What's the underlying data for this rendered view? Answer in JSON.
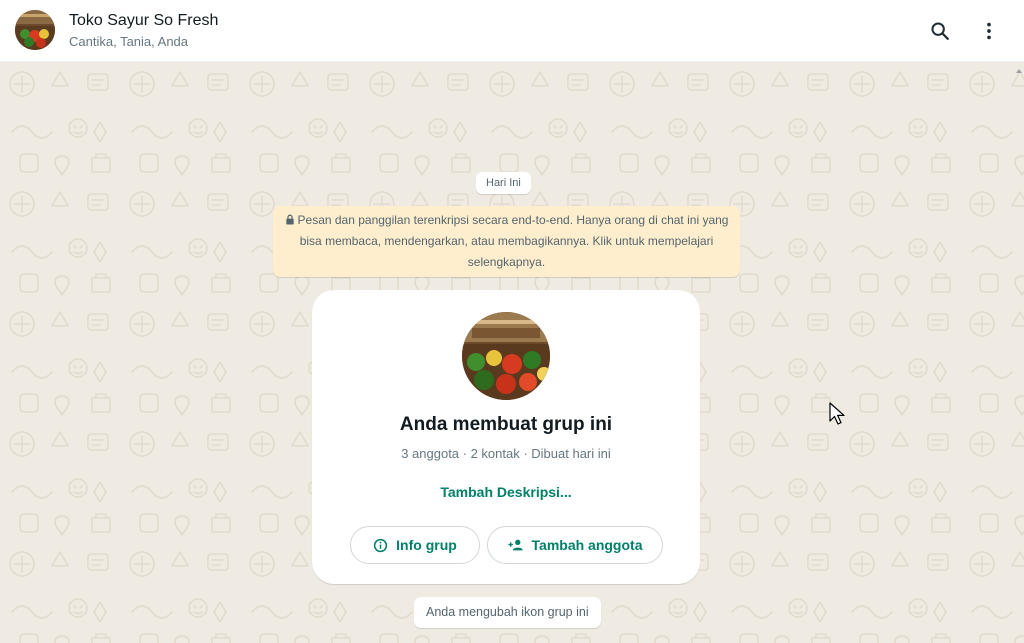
{
  "header": {
    "title": "Toko Sayur So Fresh",
    "subtitle": "Cantika, Tania, Anda",
    "avatar_icon": "group-photo-vegetables",
    "search_icon": "search-icon",
    "menu_icon": "more-vert-icon"
  },
  "chat": {
    "date_chip": "Hari Ini",
    "encryption_notice": "Pesan dan panggilan terenkripsi secara end-to-end. Hanya orang di chat ini yang bisa membaca, mendengarkan, atau membagikannya. Klik untuk mempelajari selengkapnya.",
    "group_card": {
      "title": "Anda membuat grup ini",
      "meta": "3 anggota · 2 kontak · Dibuat hari ini",
      "add_description": "Tambah Deskripsi...",
      "info_button": "Info grup",
      "add_member_button": "Tambah anggota"
    },
    "system_message": "Anda mengubah ikon grup ini"
  },
  "colors": {
    "accent": "#008069",
    "wallpaper": "#efeae2",
    "encryption_bg": "#ffeecd"
  }
}
